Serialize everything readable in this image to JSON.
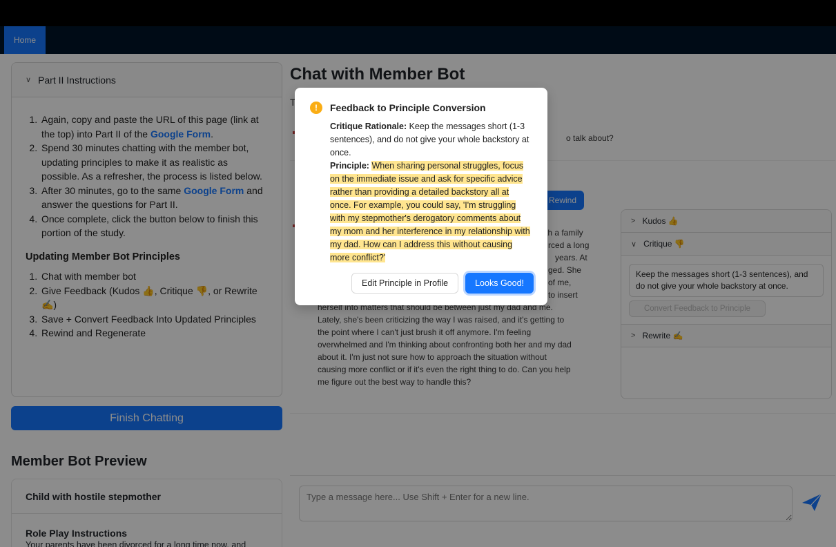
{
  "nav": {
    "home": "Home"
  },
  "instructions": {
    "header": "Part II Instructions",
    "item1_a": "Again, copy and paste the URL of this page (link at the top) into Part II of the ",
    "item1_link": "Google Form",
    "item1_b": ".",
    "item2": "Spend 30 minutes chatting with the member bot, updating principles to make it as realistic as possible. As a refresher, the process is listed below.",
    "item3_a": "After 30 minutes, go to the same ",
    "item3_link": "Google Form",
    "item3_b": " and answer the questions for Part II.",
    "item4": "Once complete, click the button below to finish this portion of the study.",
    "sub_title": "Updating Member Bot Principles",
    "steps": [
      "Chat with member bot",
      "Give Feedback (Kudos 👍, Critique 👎, or Rewrite ✍️)",
      "Save + Convert Feedback Into Updated Principles",
      "Rewind and Regenerate"
    ]
  },
  "finish_button": "Finish Chatting",
  "preview": {
    "title": "Member Bot Preview",
    "name": "Child with hostile stepmother",
    "roleplay_title": "Role Play Instructions",
    "roleplay_text": "Your parents have been divorced for a long time now, and"
  },
  "chat": {
    "title": "Chat with Member Bot",
    "subtitle_visible": "T",
    "bot_question_fragment": "o talk about?",
    "rewind_label": "Rewind",
    "message_fragments": [
      "th a family",
      "rced a long",
      "years. At",
      "ged. She",
      "of me,",
      "to insert"
    ],
    "message_lines": [
      "herself into matters that should be between just my dad and me.",
      "Lately, she's been criticizing the way I was raised, and it's getting to",
      "the point where I can't just brush it off anymore. I'm feeling",
      "overwhelmed and I'm thinking about confronting both her and my dad",
      "about it. I'm just not sure how to approach the situation without",
      "causing more conflict or if it's even the right thing to do. Can you help",
      "me figure out the best way to handle this?"
    ],
    "input_placeholder": "Type a message here... Use Shift + Enter for a new line."
  },
  "feedback": {
    "kudos": "Kudos 👍",
    "critique": "Critique 👎",
    "critique_text": "Keep the messages short (1-3 sentences), and do not give your whole backstory at once.",
    "convert_button": "Convert Feedback to Principle",
    "rewrite": "Rewrite ✍️"
  },
  "modal": {
    "title": "Feedback to Principle Conversion",
    "rationale_label": "Critique Rationale:",
    "rationale_text": " Keep the messages short (1-3 sentences), and do not give your whole backstory at once.",
    "principle_label": "Principle:",
    "principle_text": "When sharing personal struggles, focus on the immediate issue and ask for specific advice rather than providing a detailed backstory all at once. For example, you could say, 'I'm struggling with my stepmother's derogatory comments about my mom and her interference in my relationship with my dad. How can I address this without causing more conflict?'",
    "edit_button": "Edit Principle in Profile",
    "good_button": "Looks Good!"
  },
  "colors": {
    "primary": "#1677ff",
    "nav_bg": "#001529",
    "highlight": "#ffe58f",
    "warning": "#faad14"
  }
}
